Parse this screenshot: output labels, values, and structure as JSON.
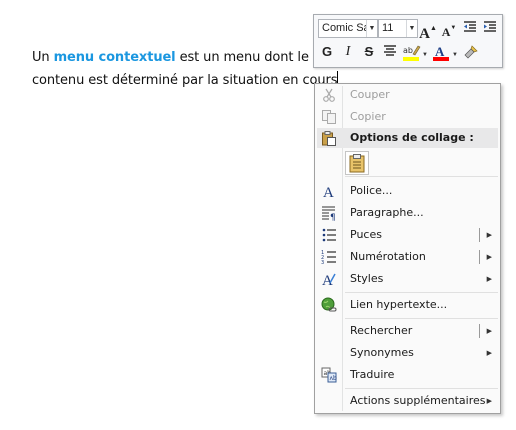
{
  "document": {
    "line1_pre": "Un ",
    "line1_highlight": "menu contextuel",
    "line1_post": " est un menu dont le",
    "line2": "contenu est déterminé par la situation en cours"
  },
  "mini_toolbar": {
    "font_name": "Comic Sa",
    "font_size": "11",
    "bold": "G",
    "italic": "I",
    "strike": "S",
    "highlight_color": "#ffff00",
    "font_color": "#ff0000"
  },
  "menu": {
    "cut": "Couper",
    "copy": "Copier",
    "paste_header": "Options de collage :",
    "font": "Police...",
    "paragraph": "Paragraphe...",
    "bullets": "Puces",
    "numbering": "Numérotation",
    "styles": "Styles",
    "hyperlink": "Lien hypertexte...",
    "search": "Rechercher",
    "synonyms": "Synonymes",
    "translate": "Traduire",
    "more_actions": "Actions supplémentaires"
  }
}
